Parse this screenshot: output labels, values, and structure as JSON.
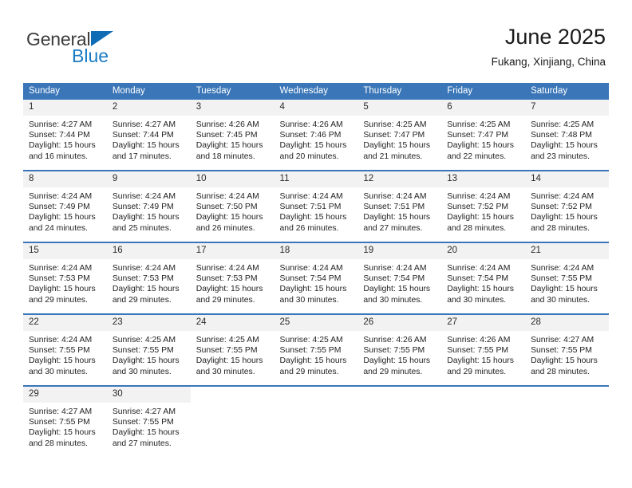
{
  "brand": {
    "word1": "General",
    "word2": "Blue",
    "triangle_color": "#0f6cb5",
    "word2_color": "#1a7bc4"
  },
  "header": {
    "title": "June 2025",
    "location": "Fukang, Xinjiang, China"
  },
  "theme": {
    "header_blue": "#3a76b8",
    "daynum_gray": "#f2f2f2",
    "text": "#1f1f1f"
  },
  "weekdays": [
    "Sunday",
    "Monday",
    "Tuesday",
    "Wednesday",
    "Thursday",
    "Friday",
    "Saturday"
  ],
  "weeks": [
    [
      {
        "day": "1",
        "sunrise": "Sunrise: 4:27 AM",
        "sunset": "Sunset: 7:44 PM",
        "daylight1": "Daylight: 15 hours",
        "daylight2": "and 16 minutes."
      },
      {
        "day": "2",
        "sunrise": "Sunrise: 4:27 AM",
        "sunset": "Sunset: 7:44 PM",
        "daylight1": "Daylight: 15 hours",
        "daylight2": "and 17 minutes."
      },
      {
        "day": "3",
        "sunrise": "Sunrise: 4:26 AM",
        "sunset": "Sunset: 7:45 PM",
        "daylight1": "Daylight: 15 hours",
        "daylight2": "and 18 minutes."
      },
      {
        "day": "4",
        "sunrise": "Sunrise: 4:26 AM",
        "sunset": "Sunset: 7:46 PM",
        "daylight1": "Daylight: 15 hours",
        "daylight2": "and 20 minutes."
      },
      {
        "day": "5",
        "sunrise": "Sunrise: 4:25 AM",
        "sunset": "Sunset: 7:47 PM",
        "daylight1": "Daylight: 15 hours",
        "daylight2": "and 21 minutes."
      },
      {
        "day": "6",
        "sunrise": "Sunrise: 4:25 AM",
        "sunset": "Sunset: 7:47 PM",
        "daylight1": "Daylight: 15 hours",
        "daylight2": "and 22 minutes."
      },
      {
        "day": "7",
        "sunrise": "Sunrise: 4:25 AM",
        "sunset": "Sunset: 7:48 PM",
        "daylight1": "Daylight: 15 hours",
        "daylight2": "and 23 minutes."
      }
    ],
    [
      {
        "day": "8",
        "sunrise": "Sunrise: 4:24 AM",
        "sunset": "Sunset: 7:49 PM",
        "daylight1": "Daylight: 15 hours",
        "daylight2": "and 24 minutes."
      },
      {
        "day": "9",
        "sunrise": "Sunrise: 4:24 AM",
        "sunset": "Sunset: 7:49 PM",
        "daylight1": "Daylight: 15 hours",
        "daylight2": "and 25 minutes."
      },
      {
        "day": "10",
        "sunrise": "Sunrise: 4:24 AM",
        "sunset": "Sunset: 7:50 PM",
        "daylight1": "Daylight: 15 hours",
        "daylight2": "and 26 minutes."
      },
      {
        "day": "11",
        "sunrise": "Sunrise: 4:24 AM",
        "sunset": "Sunset: 7:51 PM",
        "daylight1": "Daylight: 15 hours",
        "daylight2": "and 26 minutes."
      },
      {
        "day": "12",
        "sunrise": "Sunrise: 4:24 AM",
        "sunset": "Sunset: 7:51 PM",
        "daylight1": "Daylight: 15 hours",
        "daylight2": "and 27 minutes."
      },
      {
        "day": "13",
        "sunrise": "Sunrise: 4:24 AM",
        "sunset": "Sunset: 7:52 PM",
        "daylight1": "Daylight: 15 hours",
        "daylight2": "and 28 minutes."
      },
      {
        "day": "14",
        "sunrise": "Sunrise: 4:24 AM",
        "sunset": "Sunset: 7:52 PM",
        "daylight1": "Daylight: 15 hours",
        "daylight2": "and 28 minutes."
      }
    ],
    [
      {
        "day": "15",
        "sunrise": "Sunrise: 4:24 AM",
        "sunset": "Sunset: 7:53 PM",
        "daylight1": "Daylight: 15 hours",
        "daylight2": "and 29 minutes."
      },
      {
        "day": "16",
        "sunrise": "Sunrise: 4:24 AM",
        "sunset": "Sunset: 7:53 PM",
        "daylight1": "Daylight: 15 hours",
        "daylight2": "and 29 minutes."
      },
      {
        "day": "17",
        "sunrise": "Sunrise: 4:24 AM",
        "sunset": "Sunset: 7:53 PM",
        "daylight1": "Daylight: 15 hours",
        "daylight2": "and 29 minutes."
      },
      {
        "day": "18",
        "sunrise": "Sunrise: 4:24 AM",
        "sunset": "Sunset: 7:54 PM",
        "daylight1": "Daylight: 15 hours",
        "daylight2": "and 30 minutes."
      },
      {
        "day": "19",
        "sunrise": "Sunrise: 4:24 AM",
        "sunset": "Sunset: 7:54 PM",
        "daylight1": "Daylight: 15 hours",
        "daylight2": "and 30 minutes."
      },
      {
        "day": "20",
        "sunrise": "Sunrise: 4:24 AM",
        "sunset": "Sunset: 7:54 PM",
        "daylight1": "Daylight: 15 hours",
        "daylight2": "and 30 minutes."
      },
      {
        "day": "21",
        "sunrise": "Sunrise: 4:24 AM",
        "sunset": "Sunset: 7:55 PM",
        "daylight1": "Daylight: 15 hours",
        "daylight2": "and 30 minutes."
      }
    ],
    [
      {
        "day": "22",
        "sunrise": "Sunrise: 4:24 AM",
        "sunset": "Sunset: 7:55 PM",
        "daylight1": "Daylight: 15 hours",
        "daylight2": "and 30 minutes."
      },
      {
        "day": "23",
        "sunrise": "Sunrise: 4:25 AM",
        "sunset": "Sunset: 7:55 PM",
        "daylight1": "Daylight: 15 hours",
        "daylight2": "and 30 minutes."
      },
      {
        "day": "24",
        "sunrise": "Sunrise: 4:25 AM",
        "sunset": "Sunset: 7:55 PM",
        "daylight1": "Daylight: 15 hours",
        "daylight2": "and 30 minutes."
      },
      {
        "day": "25",
        "sunrise": "Sunrise: 4:25 AM",
        "sunset": "Sunset: 7:55 PM",
        "daylight1": "Daylight: 15 hours",
        "daylight2": "and 29 minutes."
      },
      {
        "day": "26",
        "sunrise": "Sunrise: 4:26 AM",
        "sunset": "Sunset: 7:55 PM",
        "daylight1": "Daylight: 15 hours",
        "daylight2": "and 29 minutes."
      },
      {
        "day": "27",
        "sunrise": "Sunrise: 4:26 AM",
        "sunset": "Sunset: 7:55 PM",
        "daylight1": "Daylight: 15 hours",
        "daylight2": "and 29 minutes."
      },
      {
        "day": "28",
        "sunrise": "Sunrise: 4:27 AM",
        "sunset": "Sunset: 7:55 PM",
        "daylight1": "Daylight: 15 hours",
        "daylight2": "and 28 minutes."
      }
    ],
    [
      {
        "day": "29",
        "sunrise": "Sunrise: 4:27 AM",
        "sunset": "Sunset: 7:55 PM",
        "daylight1": "Daylight: 15 hours",
        "daylight2": "and 28 minutes."
      },
      {
        "day": "30",
        "sunrise": "Sunrise: 4:27 AM",
        "sunset": "Sunset: 7:55 PM",
        "daylight1": "Daylight: 15 hours",
        "daylight2": "and 27 minutes."
      },
      {
        "day": "",
        "sunrise": "",
        "sunset": "",
        "daylight1": "",
        "daylight2": ""
      },
      {
        "day": "",
        "sunrise": "",
        "sunset": "",
        "daylight1": "",
        "daylight2": ""
      },
      {
        "day": "",
        "sunrise": "",
        "sunset": "",
        "daylight1": "",
        "daylight2": ""
      },
      {
        "day": "",
        "sunrise": "",
        "sunset": "",
        "daylight1": "",
        "daylight2": ""
      },
      {
        "day": "",
        "sunrise": "",
        "sunset": "",
        "daylight1": "",
        "daylight2": ""
      }
    ]
  ]
}
